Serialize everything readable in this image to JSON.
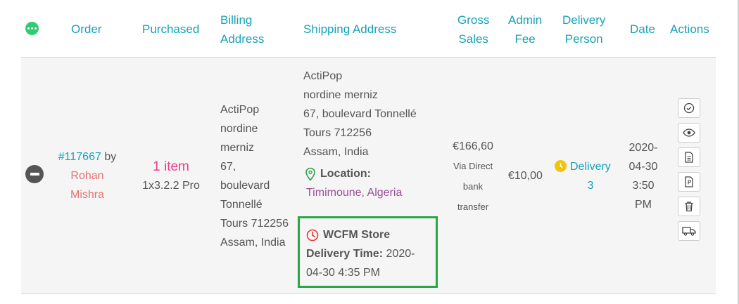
{
  "columns": {
    "order": "Order",
    "purchased": "Purchased",
    "billing": [
      "Billing",
      "Address"
    ],
    "shipping": "Shipping Address",
    "gross": [
      "Gross",
      "Sales"
    ],
    "admin": [
      "Admin",
      "Fee"
    ],
    "delivery": [
      "Delivery",
      "Person"
    ],
    "date": "Date",
    "actions": "Actions"
  },
  "row": {
    "order_number": "#117667",
    "order_by": "by",
    "customer": [
      "Rohan",
      "Mishra"
    ],
    "purchased_items": "1 item",
    "purchased_detail": "1x3.2.2 Pro",
    "billing_lines": [
      "ActiPop",
      "nordine",
      "merniz",
      "67,",
      "boulevard",
      "Tonnellé",
      "Tours 712256",
      "Assam, India"
    ],
    "shipping_lines": [
      "ActiPop",
      "nordine merniz",
      "67, boulevard Tonnellé",
      "Tours 712256",
      "Assam, India"
    ],
    "location_label": "Location:",
    "location_value": "Timimoune, Algeria",
    "store_delivery_label": "WCFM Store",
    "delivery_time_label": "Delivery Time:",
    "delivery_time_value_1": "2020-",
    "delivery_time_value_2": "04-30 4:35 PM",
    "gross_amount": "€166,60",
    "gross_method": [
      "Via Direct",
      "bank",
      "transfer"
    ],
    "admin_fee": "€10,00",
    "delivery_person": [
      "Delivery",
      "3"
    ],
    "date_lines": [
      "2020-",
      "04-30",
      "3:50",
      "PM"
    ]
  },
  "icons": {
    "header_toggle": "more-dots-icon",
    "row_collapse": "minus-circle-icon",
    "location": "map-pin-icon",
    "clock": "clock-icon",
    "delivery_status": "clock-badge-icon",
    "actions": [
      "check-circle-icon",
      "eye-icon",
      "document-icon",
      "pdf-icon",
      "trash-icon",
      "truck-icon"
    ]
  },
  "colors": {
    "accent": "#17a2b8",
    "header_toggle": "#2ecc71",
    "highlight_box": "#28a745",
    "clock_red": "#e53935",
    "location_green": "#28a745",
    "delivery_badge": "#f1c40f",
    "pink": "#e83e8c",
    "salmon": "#e57373",
    "purple": "#9b4f96"
  }
}
